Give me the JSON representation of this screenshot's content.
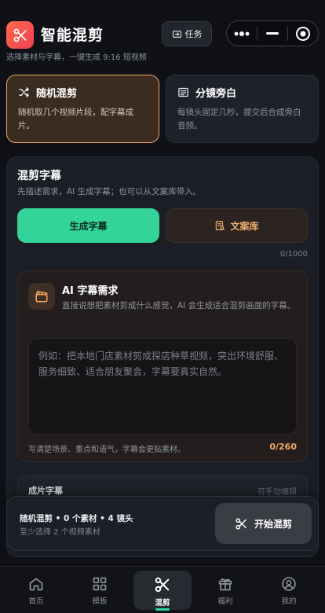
{
  "header": {
    "title": "智能混剪",
    "subtitle": "选择素材与字幕，一键生成 9:16 短视频",
    "task_label": "任务"
  },
  "modes": [
    {
      "label": "随机混剪",
      "desc": "随机取几个视频片段，配字幕成片。",
      "icon": "shuffle-icon",
      "active": true
    },
    {
      "label": "分镜旁白",
      "desc": "每镜头固定几秒，提交后合成旁白音频。",
      "icon": "list-icon",
      "active": false
    }
  ],
  "subtitle_section": {
    "title": "混剪字幕",
    "desc": "先描述需求，AI 生成字幕；也可以从文案库带入。",
    "generate_label": "生成字幕",
    "library_label": "文案库",
    "char_count": "0/1000"
  },
  "ai_request": {
    "title": "AI 字幕需求",
    "desc": "直接说想把素材剪成什么感觉，AI 会生成适合混剪画面的字幕。",
    "placeholder": "例如：把本地门店素材剪成探店种草视频，突出环境舒服、服务细致、适合朋友聚会，字幕要真实自然。",
    "hint": "写清楚场景、重点和语气，字幕会更贴素材。",
    "count": "0/260"
  },
  "output_section": {
    "title": "成片字幕",
    "hint": "可手动编辑"
  },
  "action_bar": {
    "summary": "随机混剪 • 0 个素材 • 4 镜头",
    "note": "至少选择 2 个视频素材",
    "start_label": "开始混剪"
  },
  "tabs": [
    {
      "label": "首页",
      "icon": "home-icon"
    },
    {
      "label": "模板",
      "icon": "grid-icon"
    },
    {
      "label": "混剪",
      "icon": "scissors-icon",
      "active": true
    },
    {
      "label": "福利",
      "icon": "gift-icon"
    },
    {
      "label": "我的",
      "icon": "user-icon"
    }
  ],
  "colors": {
    "accent": "#33d39a",
    "brand": "#ef4f4f",
    "highlight": "#f1a45f"
  }
}
